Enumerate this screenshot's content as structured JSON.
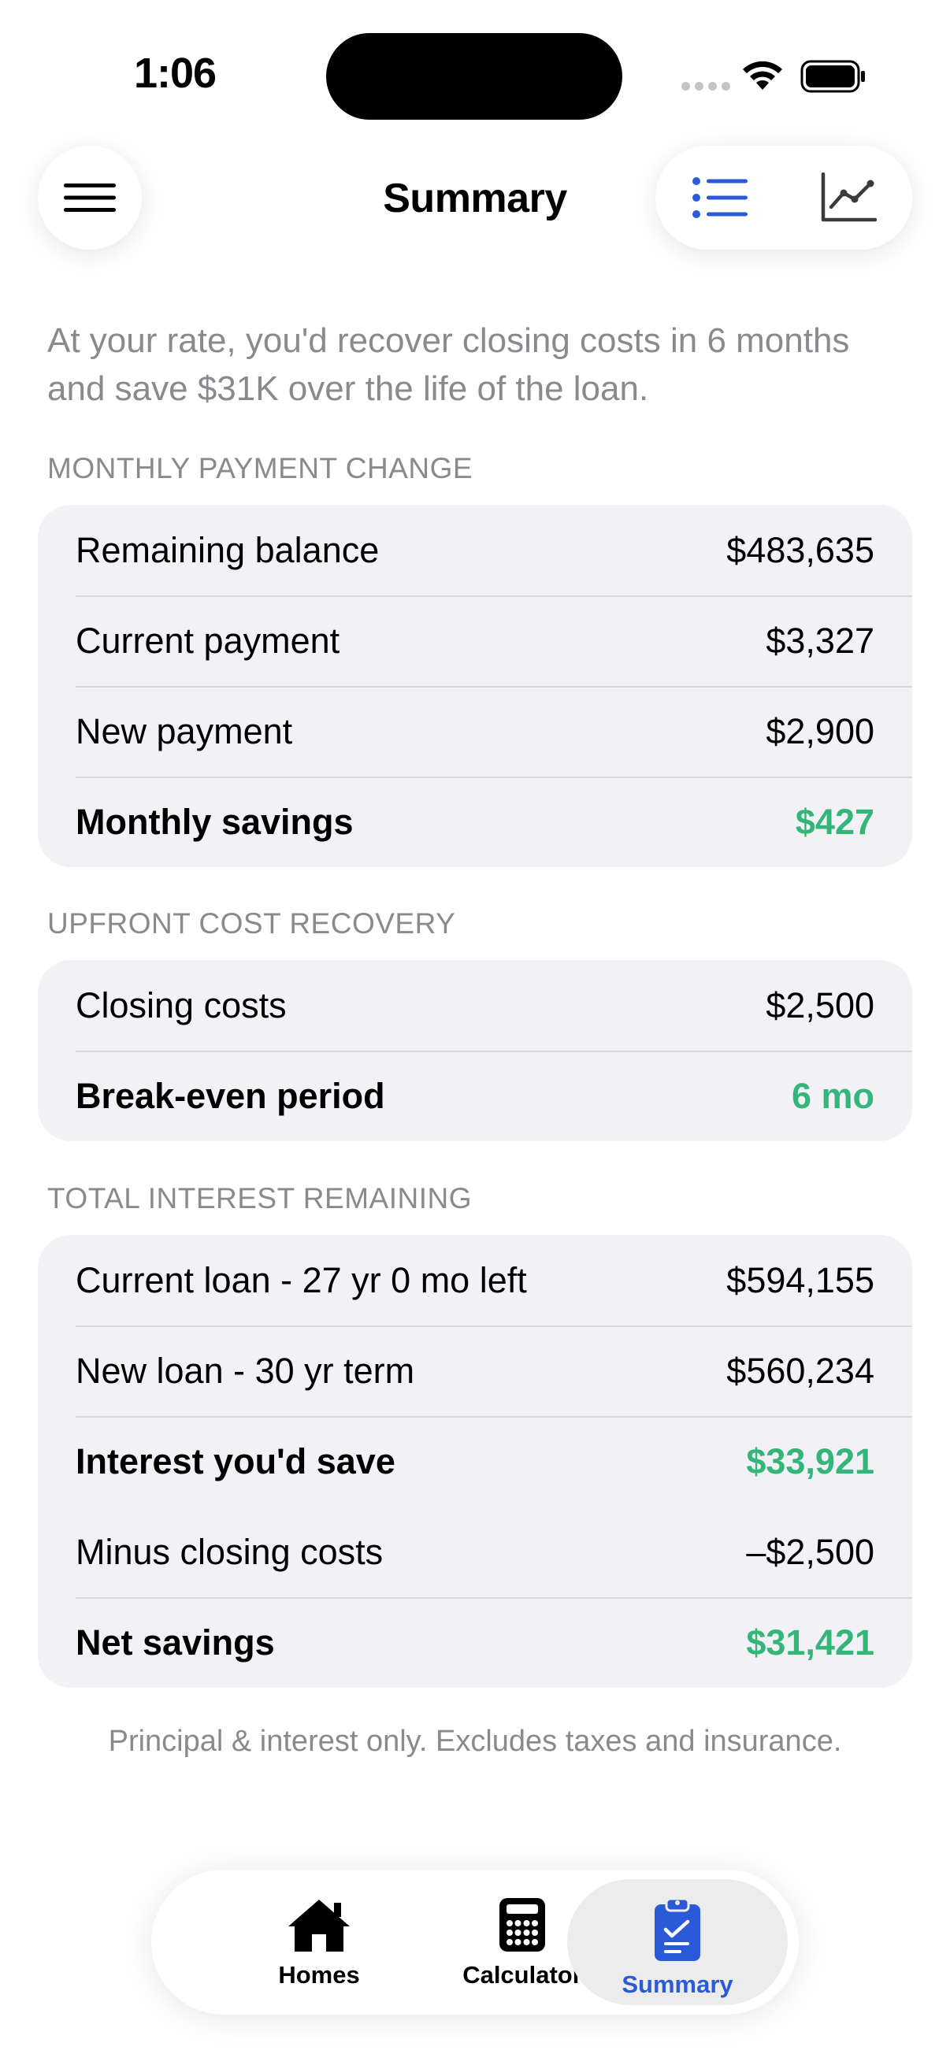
{
  "status_bar": {
    "time": "1:06"
  },
  "header": {
    "title": "Summary"
  },
  "intro": "At your rate, you'd recover closing costs in 6 months and save $31K over the life of the loan.",
  "sections": [
    {
      "label": "MONTHLY PAYMENT CHANGE",
      "rows": [
        {
          "label": "Remaining balance",
          "value": "$483,635"
        },
        {
          "label": "Current payment",
          "value": "$3,327"
        },
        {
          "label": "New payment",
          "value": "$2,900"
        },
        {
          "label": "Monthly savings",
          "value": "$427"
        }
      ]
    },
    {
      "label": "UPFRONT COST RECOVERY",
      "rows": [
        {
          "label": "Closing costs",
          "value": "$2,500"
        },
        {
          "label": "Break-even period",
          "value": "6 mo"
        }
      ]
    },
    {
      "label": "TOTAL INTEREST REMAINING",
      "rows": [
        {
          "label": "Current loan - 27 yr 0 mo left",
          "value": "$594,155"
        },
        {
          "label": "New loan - 30 yr term",
          "value": "$560,234"
        },
        {
          "label": "Interest you'd save",
          "value": "$33,921"
        },
        {
          "label": "Minus closing costs",
          "value": "–$2,500"
        },
        {
          "label": "Net savings",
          "value": "$31,421"
        }
      ]
    }
  ],
  "footnote": "Principal & interest only. Excludes taxes and insurance.",
  "tabs": [
    {
      "label": "Homes",
      "icon": "house-icon"
    },
    {
      "label": "Calculator",
      "icon": "calculator-icon"
    },
    {
      "label": "Summary",
      "icon": "clipboard-check-icon",
      "active": true
    }
  ],
  "colors": {
    "accent": "#2a5ad8",
    "positive": "#34b67a",
    "secondary_text": "#8a8a8e",
    "card_bg": "#f1f1f6"
  }
}
